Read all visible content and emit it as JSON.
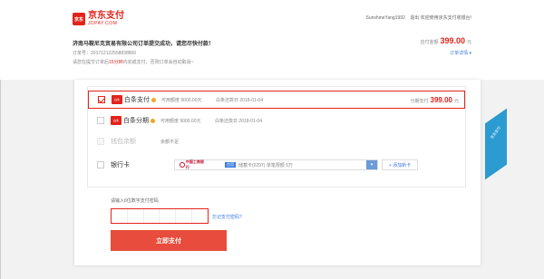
{
  "header": {
    "logo_mark": "京东",
    "logo_cn": "京东支付",
    "logo_en": "JDPAY.COM",
    "welcome_user": "SunshineYang1992",
    "welcome_logout": "退出",
    "welcome_text": "欢迎使用京东支付收银台!"
  },
  "order": {
    "title": "济南马鞍尼克贸易有限公司订单提交成功，请您尽快付款！",
    "number_label": "订单号：",
    "number": "201712122558838800",
    "tip_prefix": "请您在提交订单后",
    "tip_highlight": "15分钟",
    "tip_suffix": "内完成支付，否则订单会自动取消~",
    "amount_label": "应付金额",
    "amount_value": "399.00",
    "amount_unit": "元",
    "detail_link": "订单详情 ▾"
  },
  "payment": {
    "baitiao": {
      "icon": "白条",
      "name": "白条支付",
      "quota_label": "可用额度",
      "quota": "9000.00元",
      "due_label": "白条还款日",
      "due": "2018-01-04",
      "installment_label": "分期支付",
      "installment_value": "399.00",
      "installment_unit": "元"
    },
    "fenqi": {
      "icon": "白条",
      "name": "白条分期",
      "quota_label": "可用额度",
      "quota": "9000.00元",
      "due_label": "白条还款日",
      "due": "2018-01-04"
    },
    "balance": {
      "name": "钱包余额",
      "note": "余额不足"
    },
    "bank": {
      "name": "银行卡",
      "bank_name": "中国工商银行",
      "card_tag": "信用",
      "card_desc": "储蓄卡(0297) 单笔限额 5万",
      "add_label": "+ 添加新卡"
    }
  },
  "password": {
    "label": "请输入6位数字支付密码",
    "forgot": "忘记支付密码?"
  },
  "submit": {
    "label": "立即支付"
  },
  "ribbon": {
    "text": "京东支付"
  },
  "colors": {
    "brand_red": "#e2231a",
    "link_blue": "#3b7ce1",
    "button_red": "#e74c3c"
  }
}
